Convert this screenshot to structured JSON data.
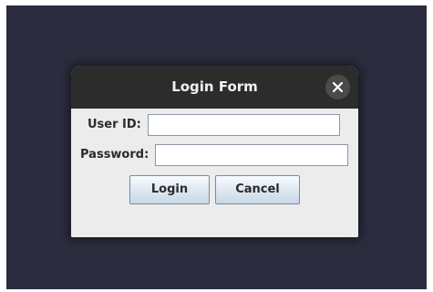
{
  "window": {
    "title": "Login Form"
  },
  "form": {
    "user_id_label": "User ID:",
    "user_id_value": "",
    "password_label": "Password:",
    "password_value": ""
  },
  "buttons": {
    "login_label": "Login",
    "cancel_label": "Cancel"
  },
  "icons": {
    "close": "close-icon"
  },
  "colors": {
    "desktop_background": "#2b2c3e",
    "titlebar": "#2c2c2c",
    "dialog_body": "#ececec"
  }
}
